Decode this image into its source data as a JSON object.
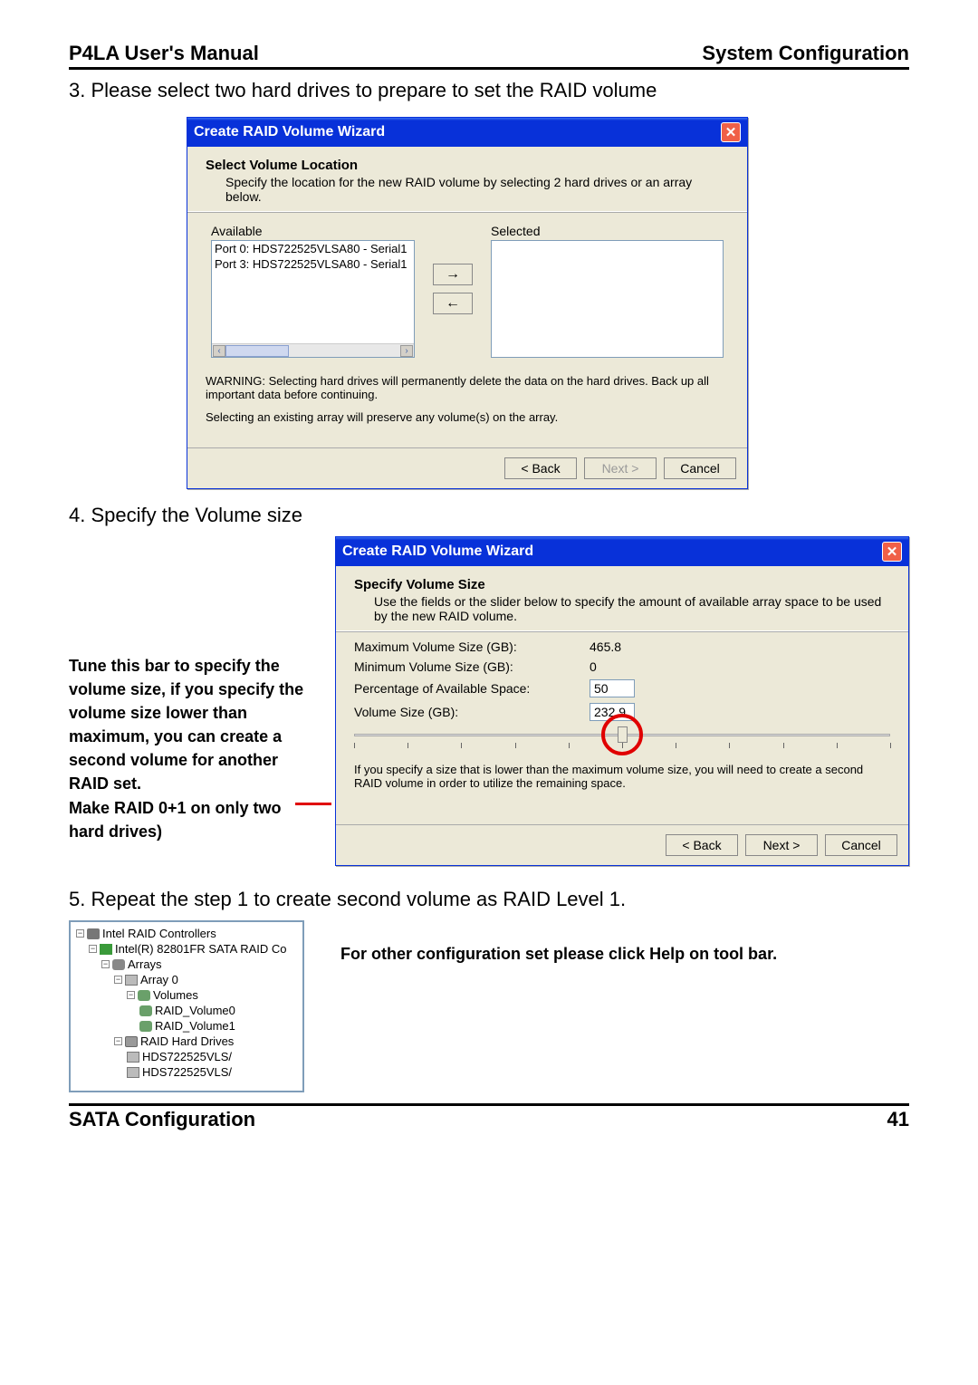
{
  "header": {
    "left": "P4LA User's Manual",
    "right": "System Configuration"
  },
  "step3": "3. Please select two hard drives to prepare to set the RAID volume",
  "dlg1": {
    "title": "Create RAID Volume Wizard",
    "subtitle": "Select Volume Location",
    "desc": "Specify the location for the new RAID volume by selecting 2 hard drives or an array below.",
    "available_label": "Available",
    "selected_label": "Selected",
    "available": [
      "Port 0: HDS722525VLSA80 - Serial1",
      "Port 3: HDS722525VLSA80 - Serial1"
    ],
    "warning": "WARNING: Selecting hard drives will permanently delete the data on the hard drives. Back up all important data before continuing.",
    "note": "Selecting an existing array will preserve any volume(s) on the array.",
    "btn_back": "< Back",
    "btn_next": "Next >",
    "btn_cancel": "Cancel"
  },
  "step4": "4. Specify the Volume size",
  "annotation_step4": "Tune this bar to specify the volume size, if you specify the volume size lower than maximum, you can create a second volume for another RAID set.\nMake RAID 0+1 on only two hard drives)",
  "dlg2": {
    "title": "Create RAID Volume Wizard",
    "subtitle": "Specify Volume Size",
    "desc": "Use the fields or the slider below to specify the amount of available array space to be used by the new RAID volume.",
    "max_label": "Maximum Volume Size (GB):",
    "max_value": "465.8",
    "min_label": "Minimum Volume Size (GB):",
    "min_value": "0",
    "pct_label": "Percentage of Available Space:",
    "pct_value": "50",
    "vol_label": "Volume Size (GB):",
    "vol_value": "232.9",
    "note": "If you specify a size that is lower than the maximum volume size, you will need to create a second RAID volume in order to utilize the remaining space.",
    "btn_back": "< Back",
    "btn_next": "Next >",
    "btn_cancel": "Cancel"
  },
  "step5": "5. Repeat the step 1 to create second volume as RAID Level 1.",
  "tree": {
    "n0": "Intel RAID Controllers",
    "n1": "Intel(R) 82801FR SATA RAID Co",
    "n2": "Arrays",
    "n3": "Array 0",
    "n4": "Volumes",
    "n5": "RAID_Volume0",
    "n6": "RAID_Volume1",
    "n7": "RAID Hard Drives",
    "n8": "HDS722525VLS/",
    "n9": "HDS722525VLS/"
  },
  "help_note": "For other configuration set please click Help on tool bar.",
  "footer": {
    "left": "SATA Configuration",
    "right": "41"
  }
}
